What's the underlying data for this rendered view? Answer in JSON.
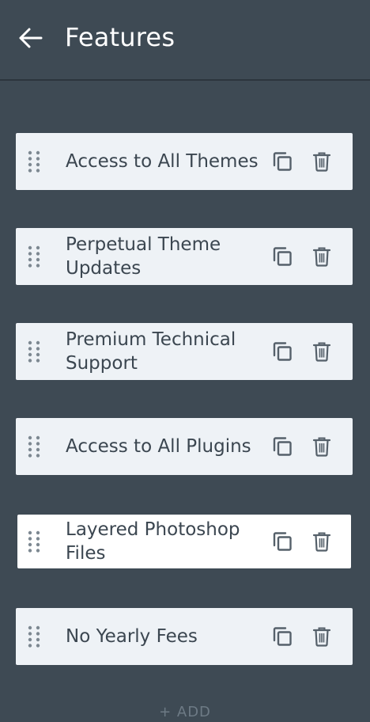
{
  "header": {
    "title": "Features",
    "back_icon": "arrow-left-icon"
  },
  "features": [
    {
      "label": "Access to All Themes"
    },
    {
      "label": "Perpetual Theme Updates"
    },
    {
      "label": "Premium Technical Support"
    },
    {
      "label": "Access to All Plugins"
    },
    {
      "label": "Layered Photoshop Files",
      "selected": true
    },
    {
      "label": "No Yearly Fees"
    }
  ],
  "item_icons": {
    "drag": "drag-handle-icon",
    "duplicate": "duplicate-icon",
    "delete": "trash-icon"
  },
  "footer": {
    "add_label": "+ ADD"
  },
  "colors": {
    "background": "#3e4a54",
    "item_background": "#eef2f6",
    "item_selected_background": "#ffffff",
    "item_text": "#3b4650",
    "icon": "#55606a"
  }
}
